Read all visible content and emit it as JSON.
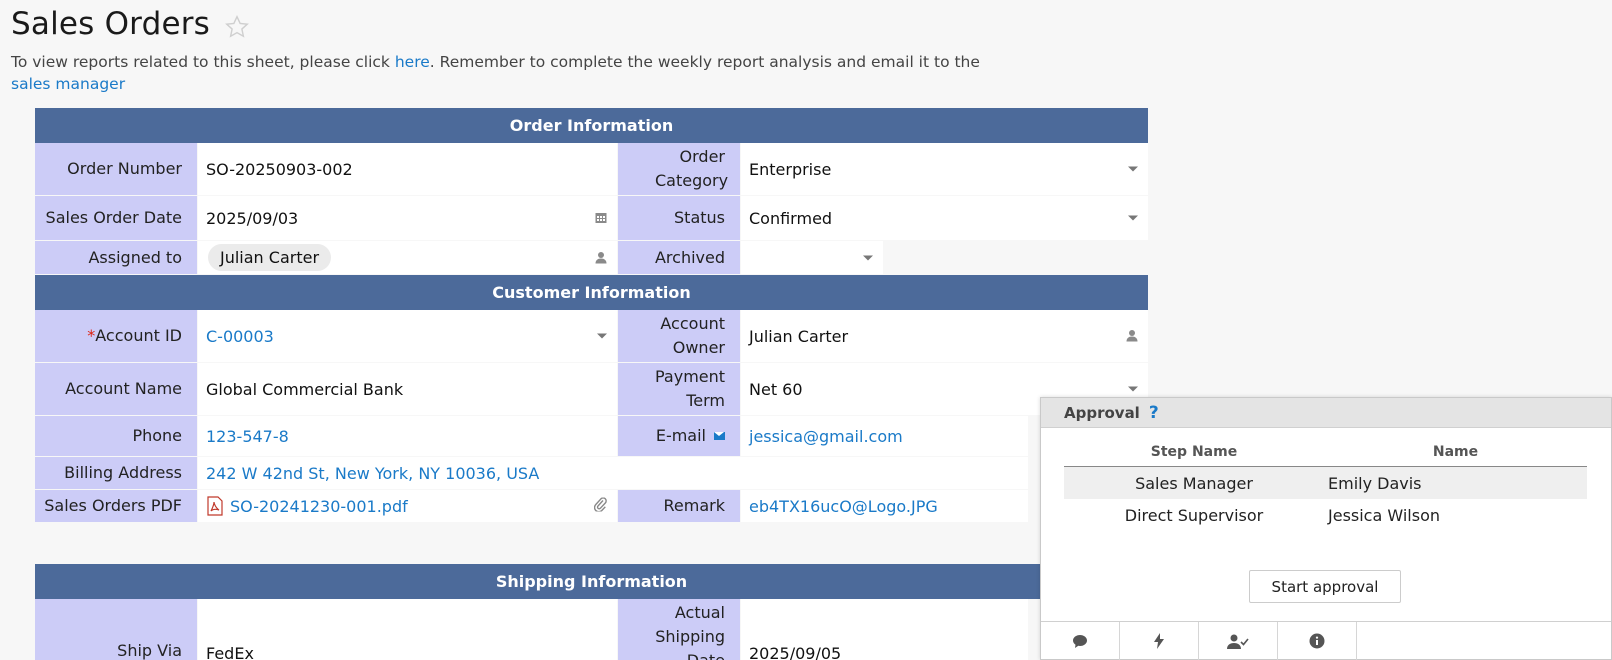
{
  "page": {
    "title": "Sales Orders",
    "intro_text_1": "To view reports related to this sheet, please click ",
    "intro_link_1": "here",
    "intro_text_2": ". Remember to complete the weekly report analysis and email it to the ",
    "intro_link_2": "sales manager"
  },
  "sections": {
    "order": "Order Information",
    "customer": "Customer Information",
    "shipping": "Shipping Information"
  },
  "fields": {
    "order_number": {
      "label": "Order Number",
      "value": "SO-20250903-002"
    },
    "order_category": {
      "label": "Order Category",
      "value": "Enterprise"
    },
    "sales_order_date": {
      "label": "Sales Order Date",
      "value": "2025/09/03"
    },
    "status": {
      "label": "Status",
      "value": "Confirmed"
    },
    "assigned_to": {
      "label": "Assigned to",
      "value": "Julian Carter"
    },
    "archived": {
      "label": "Archived",
      "value": ""
    },
    "account_id": {
      "required_mark": "*",
      "label": "Account ID",
      "value": "C-00003"
    },
    "account_owner": {
      "label": "Account Owner",
      "value": "Julian Carter"
    },
    "account_name": {
      "label": "Account Name",
      "value": "Global Commercial Bank"
    },
    "payment_term": {
      "label": "Payment Term",
      "value": "Net 60"
    },
    "phone": {
      "label": "Phone",
      "value": "123-547-8"
    },
    "email": {
      "label": "E-mail",
      "value": "jessica@gmail.com"
    },
    "billing_address": {
      "label": "Billing Address",
      "value": "242 W 42nd St, New York, NY 10036, USA"
    },
    "sales_orders_pdf": {
      "label": "Sales Orders PDF",
      "value": "SO-20241230-001.pdf"
    },
    "remark": {
      "label": "Remark",
      "value": "eb4TX16ucO@Logo.JPG"
    },
    "ship_via": {
      "label": "Ship Via",
      "value": "FedEx"
    },
    "actual_shipping": {
      "label": "Actual Shipping Date",
      "value": "2025/09/05"
    }
  },
  "approval": {
    "title": "Approval",
    "help": "?",
    "columns": [
      "Step Name",
      "Name"
    ],
    "rows": [
      {
        "step": "Sales Manager",
        "name": "Emily Davis"
      },
      {
        "step": "Direct Supervisor",
        "name": "Jessica Wilson"
      }
    ],
    "start_button": "Start approval",
    "footer_icons": [
      "comment-icon",
      "lightning-icon",
      "user-check-icon",
      "info-icon"
    ]
  },
  "colors": {
    "header_bg": "#4c6a9a",
    "label_bg": "#ccccf7",
    "link": "#1a7ac8"
  }
}
